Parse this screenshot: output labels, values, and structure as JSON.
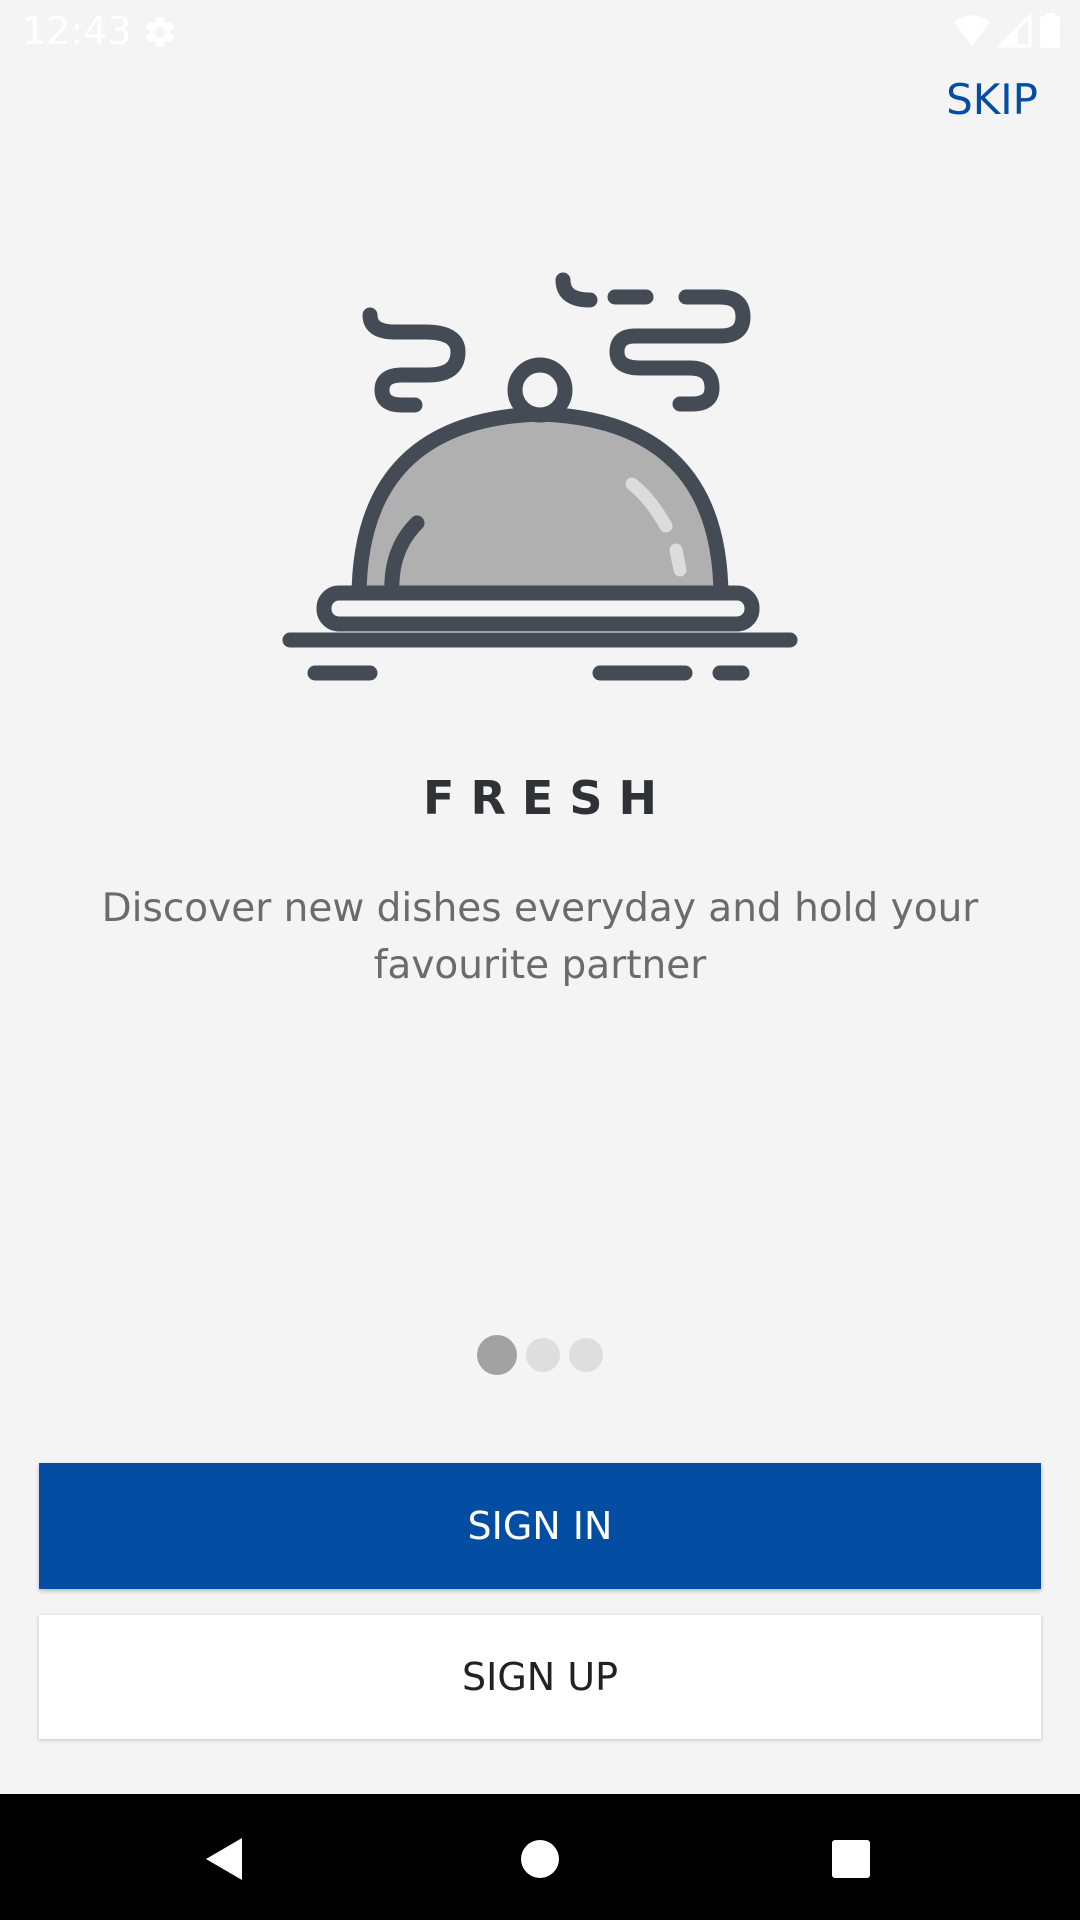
{
  "status_bar": {
    "time": "12:43",
    "icons": [
      "settings-gear-icon",
      "wifi-icon",
      "cell-signal-icon",
      "battery-icon"
    ]
  },
  "header": {
    "skip_label": "SKIP"
  },
  "onboarding": {
    "illustration": "serving-cloche-icon",
    "title": "FRESH",
    "description": "Discover new dishes everyday and hold your favourite partner",
    "page_indicator": {
      "current": 1,
      "total": 3
    }
  },
  "actions": {
    "sign_in_label": "SIGN IN",
    "sign_up_label": "SIGN UP"
  },
  "nav_bar": {
    "icons": [
      "back-icon",
      "home-icon",
      "recents-icon"
    ]
  },
  "colors": {
    "accent": "#034ea2",
    "background": "#f4f4f4",
    "title": "#2f3136",
    "description": "#6b6b6b",
    "illustration_stroke": "#454b55",
    "illustration_fill": "#b0b0b0"
  }
}
